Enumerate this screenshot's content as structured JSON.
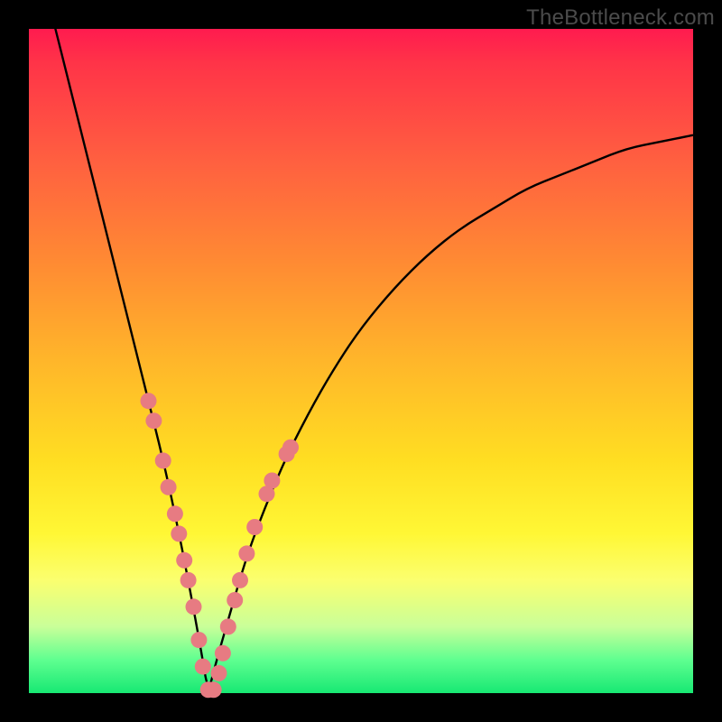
{
  "watermark": "TheBottleneck.com",
  "chart_data": {
    "type": "line",
    "title": "",
    "xlabel": "",
    "ylabel": "",
    "xlim": [
      0,
      100
    ],
    "ylim": [
      0,
      100
    ],
    "grid": false,
    "legend": false,
    "notes": "V-shaped bottleneck curve over a green-to-red heat gradient. Minimum is approximately at x≈27. Pink markers cluster along the curve near the trough.",
    "series": [
      {
        "name": "bottleneck-curve",
        "x": [
          4,
          6,
          8,
          10,
          12,
          14,
          16,
          18,
          20,
          22,
          24,
          26,
          27,
          28,
          30,
          32,
          34,
          38,
          42,
          46,
          50,
          55,
          60,
          65,
          70,
          75,
          80,
          85,
          90,
          95,
          100
        ],
        "y": [
          100,
          92,
          84,
          76,
          68,
          60,
          52,
          44,
          36,
          27,
          17,
          6,
          0,
          4,
          11,
          18,
          24,
          34,
          42,
          49,
          55,
          61,
          66,
          70,
          73,
          76,
          78,
          80,
          82,
          83,
          84
        ]
      }
    ],
    "markers": [
      {
        "x": 18.0,
        "y": 44
      },
      {
        "x": 18.8,
        "y": 41
      },
      {
        "x": 20.2,
        "y": 35
      },
      {
        "x": 21.0,
        "y": 31
      },
      {
        "x": 22.0,
        "y": 27
      },
      {
        "x": 22.6,
        "y": 24
      },
      {
        "x": 23.4,
        "y": 20
      },
      {
        "x": 24.0,
        "y": 17
      },
      {
        "x": 24.8,
        "y": 13
      },
      {
        "x": 25.6,
        "y": 8
      },
      {
        "x": 26.2,
        "y": 4
      },
      {
        "x": 27.0,
        "y": 0.5
      },
      {
        "x": 27.8,
        "y": 0.5
      },
      {
        "x": 28.6,
        "y": 3
      },
      {
        "x": 29.2,
        "y": 6
      },
      {
        "x": 30.0,
        "y": 10
      },
      {
        "x": 31.0,
        "y": 14
      },
      {
        "x": 31.8,
        "y": 17
      },
      {
        "x": 32.8,
        "y": 21
      },
      {
        "x": 34.0,
        "y": 25
      },
      {
        "x": 35.8,
        "y": 30
      },
      {
        "x": 36.6,
        "y": 32
      },
      {
        "x": 38.8,
        "y": 36
      },
      {
        "x": 39.4,
        "y": 37
      }
    ]
  },
  "colors": {
    "marker_fill": "#e77b82",
    "curve_stroke": "#000000"
  }
}
